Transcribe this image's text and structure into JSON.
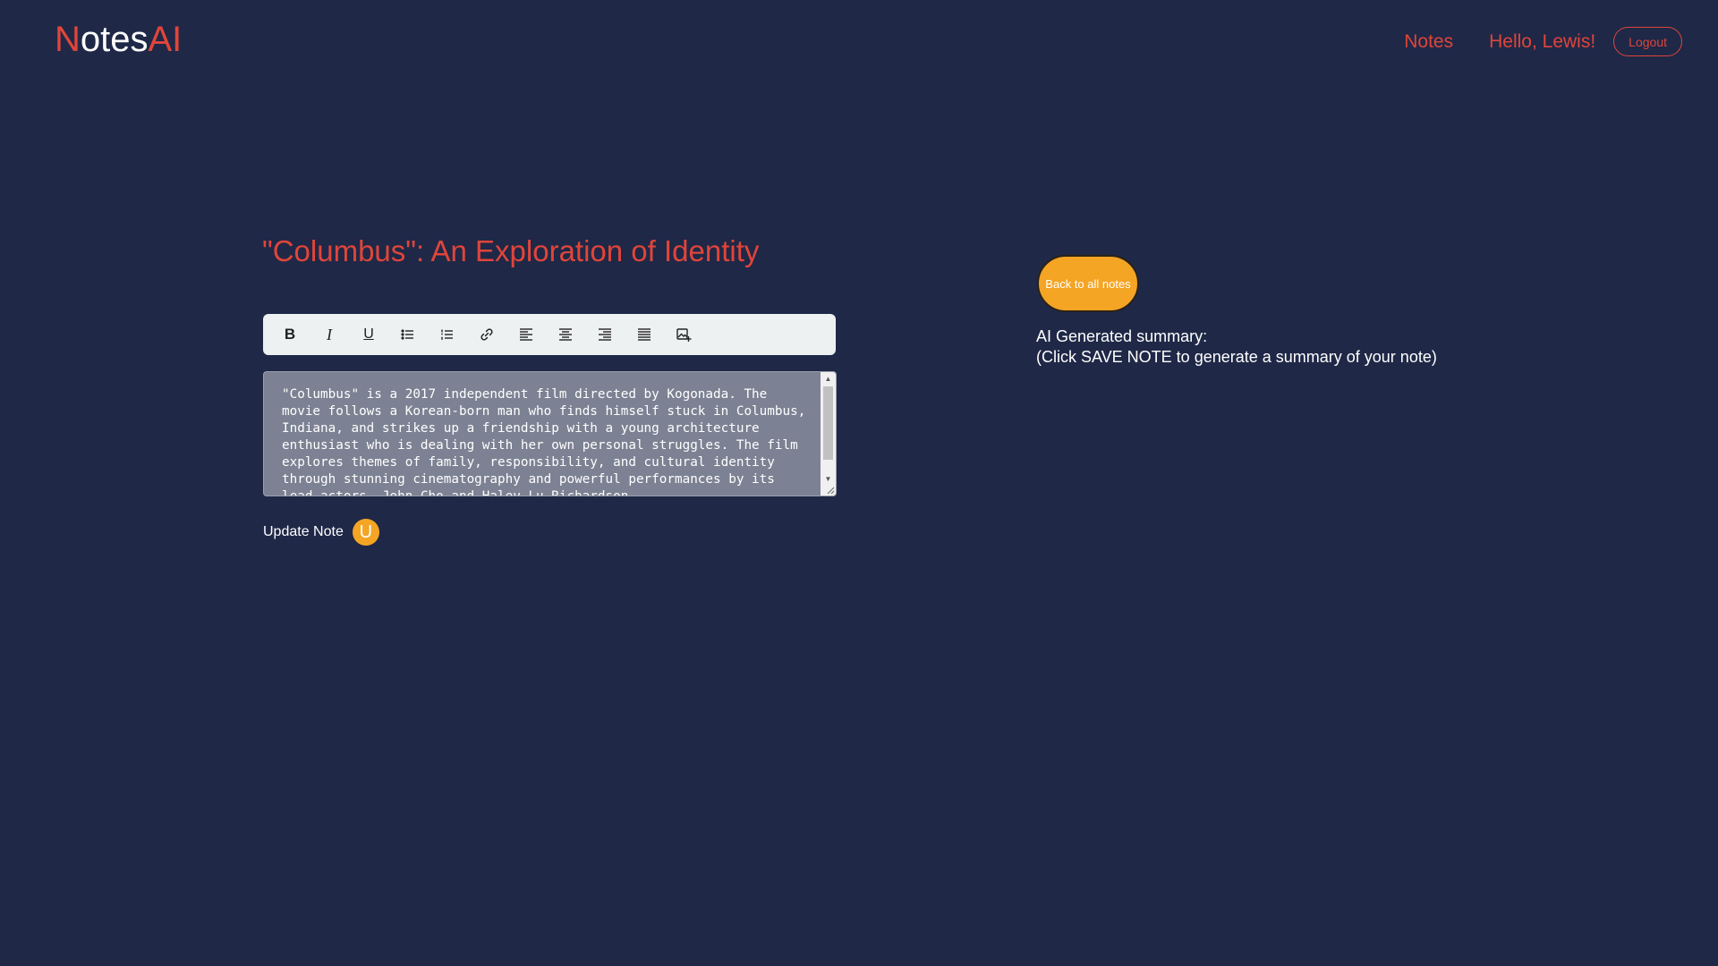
{
  "header": {
    "logo_n": "N",
    "logo_otes": "otes",
    "logo_ai": "AI",
    "nav_notes": "Notes",
    "greeting": "Hello, Lewis!",
    "logout": "Logout"
  },
  "note": {
    "title": "\"Columbus\": An Exploration of Identity",
    "content": "\"Columbus\" is a 2017 independent film directed by Kogonada. The movie follows a Korean-born man who finds himself stuck in Columbus, Indiana, and strikes up a friendship with a young architecture enthusiast who is dealing with her own personal struggles. The film explores themes of family, responsibility, and cultural identity through stunning cinematography and powerful performances by its lead actors, John Cho and Haley Lu Richardson."
  },
  "toolbar": {
    "items": [
      "bold",
      "italic",
      "underline",
      "bullet-list",
      "numbered-list",
      "link",
      "align-left",
      "align-center",
      "align-right",
      "align-justify",
      "insert-image"
    ]
  },
  "update": {
    "label": "Update Note",
    "button": "U"
  },
  "sidebar": {
    "back_button": "Back to all notes",
    "summary_title": "AI Generated summary:",
    "summary_hint": "(Click SAVE NOTE to generate a summary of your note)"
  },
  "colors": {
    "background": "#1f2847",
    "accent_red": "#e0453a",
    "accent_orange": "#f5a524",
    "editor_bg": "#7c8293"
  }
}
